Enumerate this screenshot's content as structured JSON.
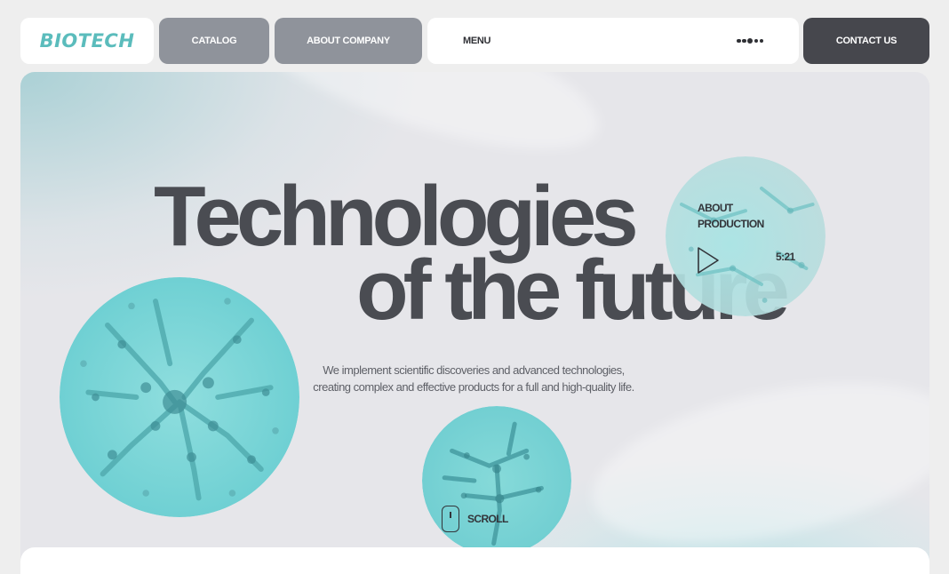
{
  "brand": {
    "logo_text": "BIOTECH",
    "accent_color": "#5bbcbc"
  },
  "nav": {
    "catalog_label": "CATALOG",
    "about_label": "ABOUT COMPANY",
    "menu_label": "MENU",
    "menu_icon": "dots-icon",
    "contact_label": "CONTACT US"
  },
  "hero": {
    "headline_line1": "Technologies",
    "headline_line2": "of the future",
    "tagline_line1": "We implement scientific discoveries and advanced technologies,",
    "tagline_line2": "creating complex and effective products for a full and high-quality life."
  },
  "video": {
    "label_line1": "ABOUT",
    "label_line2": "PRODUCTION",
    "duration": "5:21",
    "icon": "play-icon"
  },
  "scroll": {
    "label": "SCROLL",
    "icon": "mouse-icon"
  },
  "colors": {
    "nav_gray": "#8f939b",
    "contact_dark": "#46474d",
    "headline": "#4a4c52",
    "cell_teal": "#7fd6d6"
  }
}
